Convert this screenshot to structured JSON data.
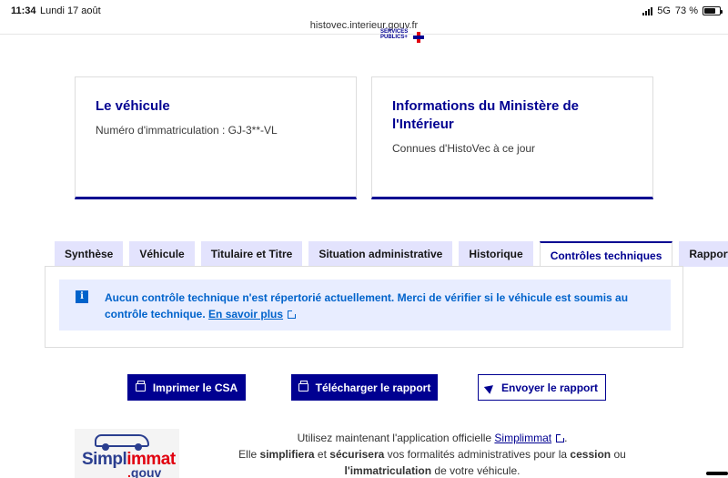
{
  "statusbar": {
    "time": "11:34",
    "date": "Lundi 17 août",
    "network": "5G",
    "battery": "73 %",
    "battery_level": 0.73,
    "url": "histovec.interieur.gouv.fr"
  },
  "brand": {
    "line1": "SERVICES",
    "line2": "PUBLICS+"
  },
  "cards": [
    {
      "title": "Le véhicule",
      "text": "Numéro d'immatriculation : GJ-3**-VL"
    },
    {
      "title": "Informations du Ministère de l'Intérieur",
      "text": "Connues d'HistoVec à ce jour"
    }
  ],
  "tabs": [
    {
      "label": "Synthèse"
    },
    {
      "label": "Véhicule"
    },
    {
      "label": "Titulaire et Titre"
    },
    {
      "label": "Situation administrative"
    },
    {
      "label": "Historique"
    },
    {
      "label": "Contrôles techniques"
    },
    {
      "label": "Rapport"
    }
  ],
  "active_tab": "Contrôles techniques",
  "alert": {
    "icon": "info-icon",
    "text": "Aucun contrôle technique n'est répertorié actuellement. Merci de vérifier si le véhicule est soumis au contrôle technique.",
    "link": "En savoir plus"
  },
  "buttons": {
    "print": "Imprimer le CSA",
    "download": "Télécharger le rapport",
    "send": "Envoyer le rapport"
  },
  "footer": {
    "logo_word_a": "Simpl",
    "logo_word_b": "immat",
    "logo_sub_dot": ".",
    "logo_sub": "gouv",
    "line1_pre": "Utilisez maintenant l'application officielle",
    "line1_link": "Simplimmat",
    "line1_post": ".",
    "line2_a": "Elle",
    "line2_b": "simplifiera",
    "line2_c": "et",
    "line2_d": "sécurisera",
    "line2_e": "vos formalités administratives pour la",
    "line2_f": "cession",
    "line2_g": "ou",
    "line3_a": "l'immatriculation",
    "line3_b": "de votre véhicule."
  },
  "colors": {
    "primary": "#000091",
    "info": "#0063cb",
    "info_bg": "#e8edff",
    "tab_bg": "#e3e3fd",
    "accent_red": "#e1000f"
  }
}
